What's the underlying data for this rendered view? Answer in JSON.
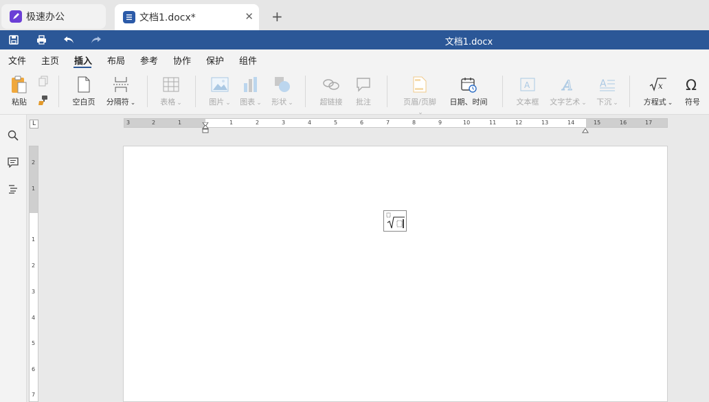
{
  "tabs": {
    "app_title": "极速办公",
    "doc_title": "文档1.docx*",
    "close": "✕",
    "new": "+"
  },
  "titlebar": {
    "doc_title": "文档1.docx"
  },
  "menu": [
    "文件",
    "主页",
    "插入",
    "布局",
    "参考",
    "协作",
    "保护",
    "组件"
  ],
  "ribbon": {
    "paste": "粘贴",
    "blank_page": "空白页",
    "page_break": "分隔符",
    "table": "表格",
    "image": "图片",
    "chart": "图表",
    "shape": "形状",
    "hyperlink": "超链接",
    "comment": "批注",
    "header_footer": "页眉/页脚",
    "date_time": "日期、时间",
    "text_box": "文本框",
    "text_art": "文字艺术",
    "drop_cap": "下沉",
    "equation": "方程式",
    "symbol": "符号"
  },
  "ruler": {
    "corner": "L",
    "h_labels": [
      "3",
      "2",
      "1",
      "1",
      "2",
      "3",
      "4",
      "5",
      "6",
      "7",
      "8",
      "9",
      "10",
      "11",
      "12",
      "13",
      "14",
      "15",
      "16",
      "17"
    ],
    "v_labels": [
      "2",
      "1",
      "1",
      "2",
      "3",
      "4",
      "5",
      "6",
      "7"
    ]
  },
  "colors": {
    "accent": "#2b5797",
    "app_icon": "#6b3fd6",
    "doc_icon": "#2b5aa8"
  }
}
